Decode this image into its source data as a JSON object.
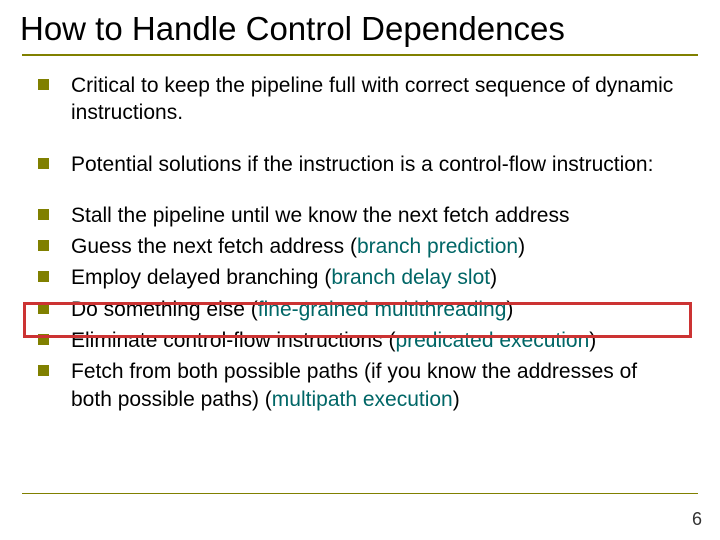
{
  "title": "How to Handle Control Dependences",
  "bullets": {
    "b1": "Critical to keep the pipeline full with correct sequence of dynamic instructions.",
    "b2": "Potential solutions if the instruction is a control-flow instruction:",
    "b3": "Stall the pipeline until we know the next fetch address",
    "b4_pre": "Guess the next fetch address (",
    "b4_kw": "branch prediction",
    "b4_post": ")",
    "b5_pre": "Employ delayed branching (",
    "b5_kw": "branch delay slot",
    "b5_post": ")",
    "b6_pre": "Do something else (",
    "b6_kw": "fine-grained multithreading",
    "b6_post": ")",
    "b7_pre": "Eliminate control-flow instructions (",
    "b7_kw": "predicated execution",
    "b7_post": ")",
    "b8_pre": "Fetch from both possible paths (if you know the addresses of both possible paths) (",
    "b8_kw": "multipath execution",
    "b8_post": ")"
  },
  "page_number": "6"
}
